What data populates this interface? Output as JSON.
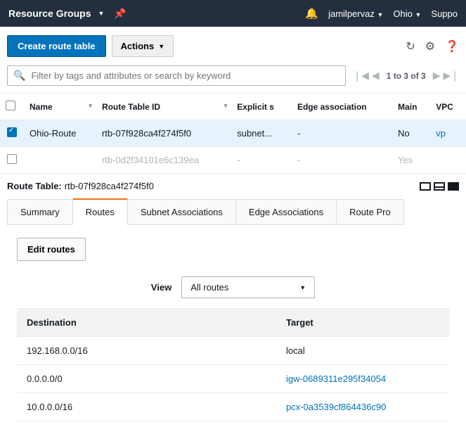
{
  "topbar": {
    "brand": "Resource Groups",
    "user": "jamilpervaz",
    "region": "Ohio",
    "support": "Suppo"
  },
  "toolbar": {
    "create": "Create route table",
    "actions": "Actions"
  },
  "filter": {
    "placeholder": "Filter by tags and attributes or search by keyword",
    "pager_text": "1 to 3 of 3"
  },
  "cols": {
    "name": "Name",
    "rtid": "Route Table ID",
    "explicit": "Explicit s",
    "edge": "Edge association",
    "main": "Main",
    "vpc": "VPC"
  },
  "rows": [
    {
      "name": "Ohio-Route",
      "rtid": "rtb-07f928ca4f274f5f0",
      "explicit": "subnet...",
      "edge": "-",
      "main": "No",
      "vpc": "vp"
    },
    {
      "name": "",
      "rtid": "rtb-0d2f34101e6c139ea",
      "explicit": "-",
      "edge": "-",
      "main": "Yes",
      "vpc": ""
    }
  ],
  "detail": {
    "label": "Route Table:",
    "id": "rtb-07f928ca4f274f5f0"
  },
  "tabs": {
    "summary": "Summary",
    "routes": "Routes",
    "subnet": "Subnet Associations",
    "edge": "Edge Associations",
    "routeprop": "Route Pro"
  },
  "content": {
    "edit": "Edit routes",
    "view_label": "View",
    "view_value": "All routes",
    "cols": {
      "dest": "Destination",
      "target": "Target"
    },
    "routes": [
      {
        "dest": "192.168.0.0/16",
        "target": "local",
        "link": false
      },
      {
        "dest": "0.0.0.0/0",
        "target": "igw-0689311e295f34054",
        "link": true
      },
      {
        "dest": "10.0.0.0/16",
        "target": "pcx-0a3539cf864436c90",
        "link": true
      }
    ]
  }
}
